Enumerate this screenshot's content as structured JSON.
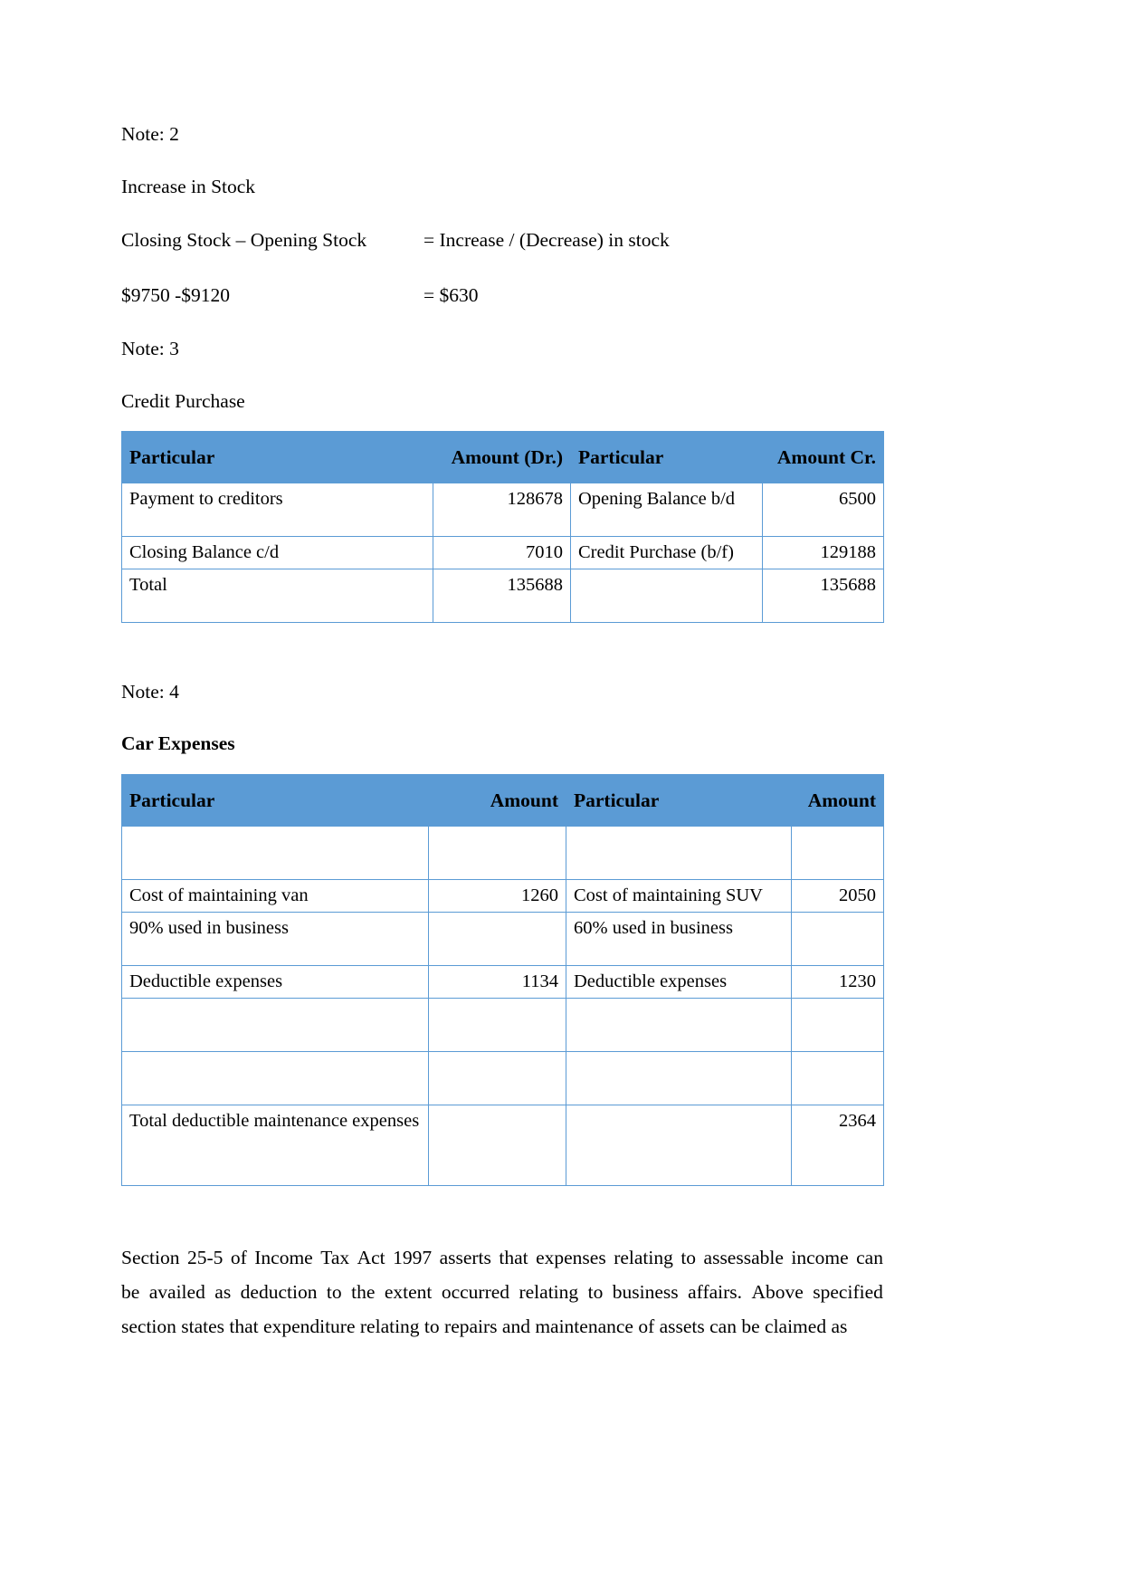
{
  "document": {
    "note2": {
      "label": "Note: 2",
      "heading": "Increase in Stock",
      "formula_left": "Closing Stock – Opening Stock",
      "formula_right": "= Increase / (Decrease) in stock",
      "values_left": "$9750 -$9120",
      "values_right": "= $630"
    },
    "note3": {
      "label": "Note: 3",
      "heading": "Credit Purchase",
      "table": {
        "headers": [
          "Particular",
          "Amount (Dr.)",
          "Particular",
          "Amount Cr."
        ],
        "rows": [
          {
            "left_label": "Payment to creditors",
            "left_amount": "128678",
            "right_label": "Opening Balance b/d",
            "right_amount": "6500"
          },
          {
            "left_label": "Closing Balance c/d",
            "left_amount": "7010",
            "right_label": "Credit Purchase (b/f)",
            "right_amount": "129188"
          },
          {
            "left_label": "Total",
            "left_amount": "135688",
            "right_label": "",
            "right_amount": "135688"
          }
        ]
      }
    },
    "note4": {
      "label": "Note: 4",
      "heading": "Car Expenses",
      "table": {
        "headers": [
          "Particular",
          "Amount",
          "Particular",
          "Amount"
        ],
        "rows": [
          {
            "left_label": "",
            "left_amount": "",
            "right_label": "",
            "right_amount": ""
          },
          {
            "left_label": "Cost of maintaining van",
            "left_amount": "1260",
            "right_label": "Cost of maintaining SUV",
            "right_amount": "2050"
          },
          {
            "left_label": "90% used in business",
            "left_amount": "",
            "right_label": "60% used in business",
            "right_amount": ""
          },
          {
            "left_label": "Deductible expenses",
            "left_amount": "1134",
            "right_label": "Deductible expenses",
            "right_amount": "1230"
          },
          {
            "left_label": "",
            "left_amount": "",
            "right_label": "",
            "right_amount": ""
          },
          {
            "left_label": "",
            "left_amount": "",
            "right_label": "",
            "right_amount": ""
          },
          {
            "left_label": "Total deductible maintenance expenses",
            "left_amount": "",
            "right_label": "",
            "right_amount": "2364"
          }
        ]
      }
    },
    "closing_paragraph": {
      "line1": "Section 25-5 of Income Tax Act 1997 asserts that expenses relating to assessable income can",
      "line2": "be availed as deduction to the extent occurred relating to business affairs. Above specified",
      "line3": "section states that expenditure relating to repairs and maintenance of assets can be claimed as"
    }
  },
  "colors": {
    "table_header_bg": "#5B9BD5",
    "table_border": "#5B9BD5",
    "text": "#000000"
  }
}
